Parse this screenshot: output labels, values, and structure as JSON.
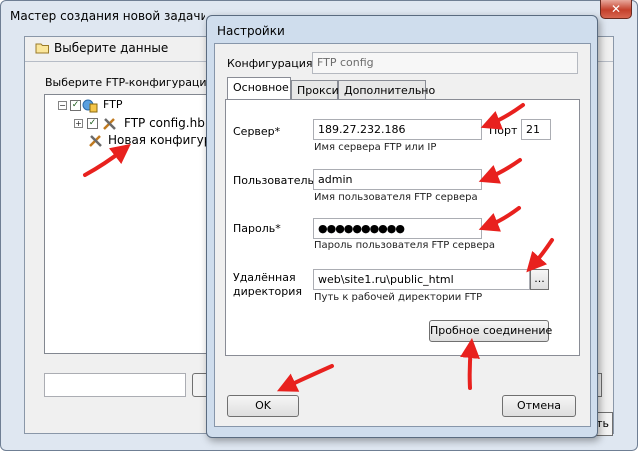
{
  "wizard": {
    "title": "Мастер создания новой задачи - Ш",
    "close_glyph": "✕",
    "step_title": "Выберите данные",
    "instruction": "Выберите FTP-конфигурацию. Ч",
    "tree": {
      "root_label": "FTP",
      "expand_glyph_root": "−",
      "expand_glyph_child": "+",
      "check_glyph": "✓",
      "item_config": "FTP config.hbl",
      "item_new": "Новая конфигурац"
    },
    "back_button_tail": "ть"
  },
  "dialog": {
    "title": "Настройки",
    "config_label": "Конфигурация",
    "config_value": "FTP config",
    "tabs": [
      "Основное",
      "Прокси",
      "Дополнительно"
    ],
    "server_label": "Сервер*",
    "server_value": "189.27.232.186",
    "server_hint": "Имя сервера FTP или IP",
    "port_label": "Порт",
    "port_value": "21",
    "user_label": "Пользователь*",
    "user_value": "admin",
    "user_hint": "Имя пользователя FTP сервера",
    "password_label": "Пароль*",
    "password_value": "●●●●●●●●●●",
    "password_hint": "Пароль пользователя FTP сервера",
    "remote_dir_label_1": "Удалённая",
    "remote_dir_label_2": "директория",
    "remote_dir_value": "web\\site1.ru\\public_html",
    "browse_label": "...",
    "remote_dir_hint": "Путь к рабочей директории FTP",
    "test_button": "Пробное соединение",
    "ok_button": "OK",
    "cancel_button": "Отмена"
  },
  "colors": {
    "annotation_arrow": "#e8211e"
  }
}
